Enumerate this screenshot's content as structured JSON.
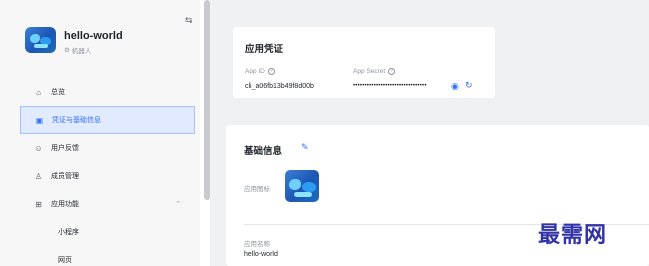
{
  "sidebar": {
    "collapse_icon": "⇆",
    "app": {
      "name": "hello-world",
      "type_label": "机器人",
      "type_icon": "robot-icon"
    },
    "items": [
      {
        "label": "总览",
        "icon": "home-icon",
        "glyph": "⌂"
      },
      {
        "label": "凭证与基础信息",
        "icon": "credential-icon",
        "glyph": "▣",
        "active": true
      },
      {
        "label": "用户反馈",
        "icon": "feedback-icon",
        "glyph": "☺"
      },
      {
        "label": "成员管理",
        "icon": "member-icon",
        "glyph": "♙"
      },
      {
        "label": "应用功能",
        "icon": "grid-icon",
        "glyph": "⊞",
        "expanded": true
      }
    ],
    "sub_items": [
      {
        "label": "小程序"
      },
      {
        "label": "网页"
      }
    ]
  },
  "credentials": {
    "title": "应用凭证",
    "app_id_label": "App ID",
    "app_id_value": "cli_a06fb13b49f8d00b",
    "app_secret_label": "App Secret",
    "app_secret_value": "••••••••••••••••••••••••••••••••",
    "help_glyph": "?",
    "eye_icon": "◉",
    "refresh_icon": "↻"
  },
  "basic_info": {
    "title": "基础信息",
    "edit_icon": "✎",
    "icon_label": "应用图标",
    "name_label": "应用名称",
    "name_value": "hello-world"
  },
  "watermark": "最需网",
  "colors": {
    "accent": "#3370ff",
    "active_bg": "#e1eaff",
    "sidebar_bg": "#f7f7f8",
    "main_bg": "#f0f1f3"
  }
}
